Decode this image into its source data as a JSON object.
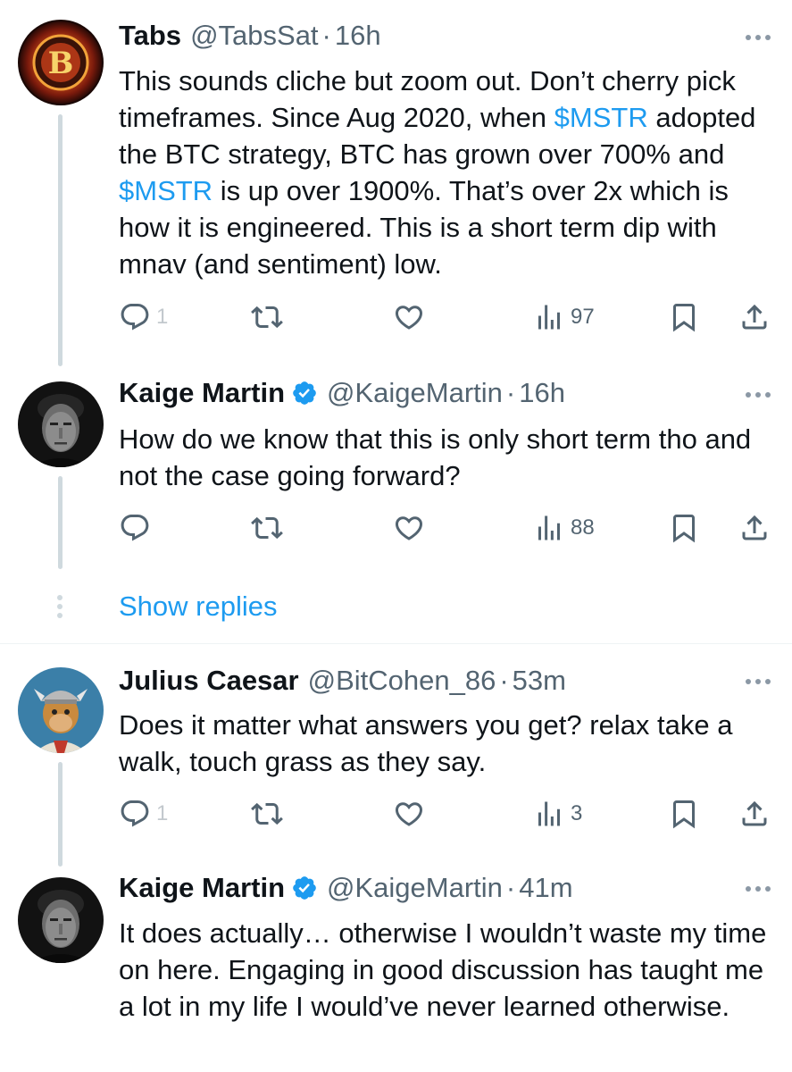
{
  "tweets": [
    {
      "name": "Tabs",
      "handle": "@TabsSat",
      "separator": "·",
      "time": "16h",
      "body_parts": [
        "This sounds cliche but zoom out. Don’t cherry pick timeframes. Since Aug 2020, when ",
        "$MSTR",
        " adopted the BTC strategy, BTC has grown over 700% and ",
        "$MSTR",
        " is up over 1900%. That’s over 2x which is how it is engineered. This is a short term dip with mnav (and sentiment) low."
      ],
      "reply_count": "1",
      "view_count": "97"
    },
    {
      "name": "Kaige Martin",
      "handle": "@KaigeMartin",
      "separator": "·",
      "time": "16h",
      "body": "How do we know that this is only short term tho and not the case going forward?",
      "view_count": "88"
    },
    {
      "name": "Julius Caesar",
      "handle": "@BitCohen_86",
      "separator": "·",
      "time": "53m",
      "body": "Does it matter what answers you get? relax take a walk, touch grass as they say.",
      "reply_count": "1",
      "view_count": "3"
    },
    {
      "name": "Kaige Martin",
      "handle": "@KaigeMartin",
      "separator": "·",
      "time": "41m",
      "body": "It does actually… otherwise I wouldn’t waste my time on here. Engaging in good discussion has taught me a lot in my life I would’ve never learned otherwise."
    }
  ],
  "show_replies_label": "Show replies",
  "colors": {
    "link": "#1d9bf0",
    "text": "#0f1419",
    "secondary": "#536471",
    "thread_line": "#cfd9de",
    "verified": "#1d9bf0"
  },
  "icons": [
    "reply-icon",
    "retweet-icon",
    "like-icon",
    "views-icon",
    "bookmark-icon",
    "share-icon",
    "more-icon",
    "verified-badge-icon",
    "bitcoin-logo-avatar",
    "portrait-avatar",
    "ape-avatar"
  ]
}
